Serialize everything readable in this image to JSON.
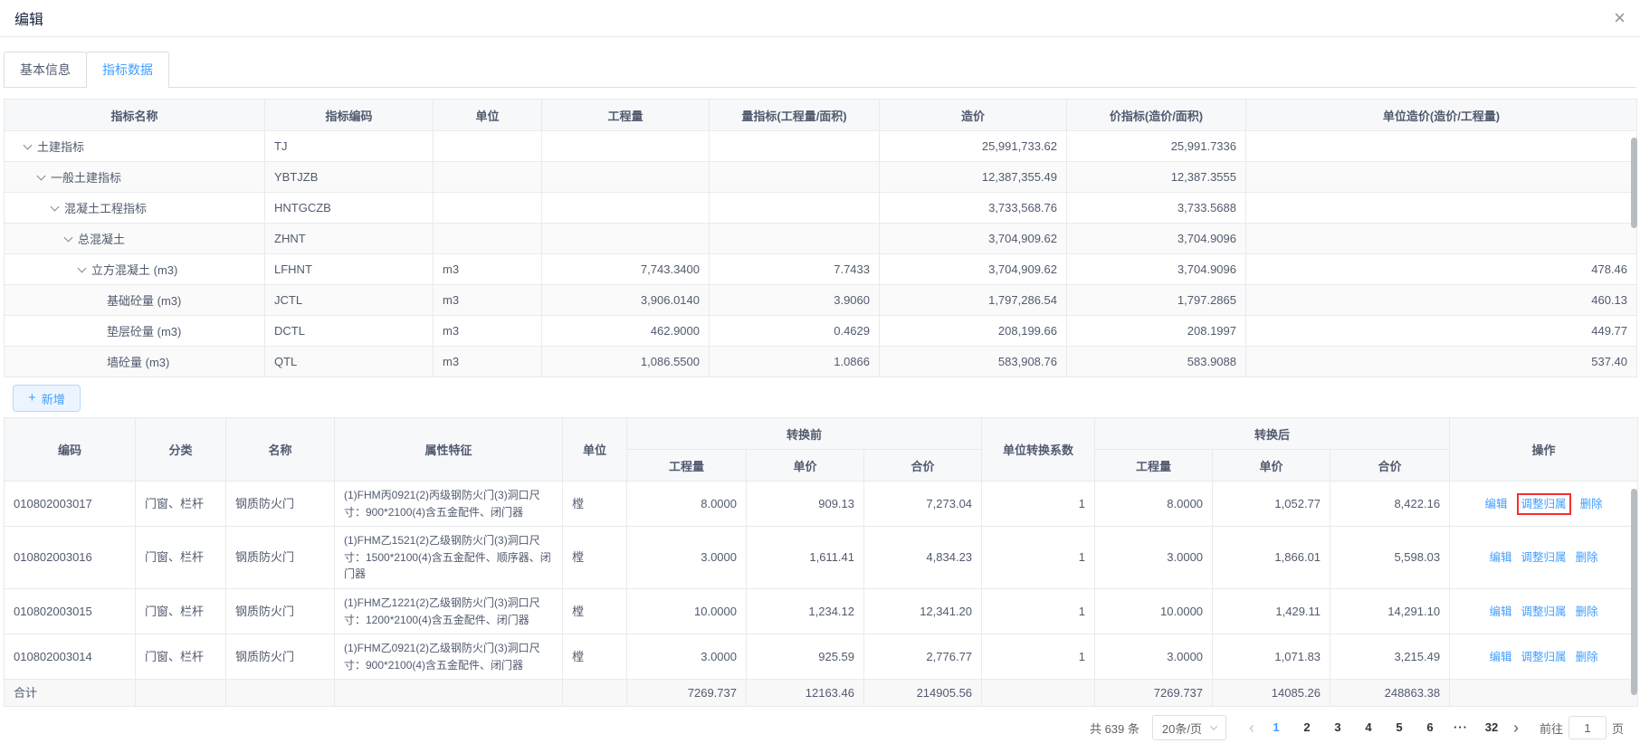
{
  "window": {
    "title": "编辑",
    "close_icon": "×"
  },
  "tabs": [
    {
      "label": "基本信息",
      "active": false
    },
    {
      "label": "指标数据",
      "active": true
    }
  ],
  "indicator_table": {
    "columns": [
      "指标名称",
      "指标编码",
      "单位",
      "工程量",
      "量指标(工程量/面积)",
      "造价",
      "价指标(造价/面积)",
      "单位造价(造价/工程量)"
    ],
    "rows": [
      {
        "level": 0,
        "expandable": true,
        "name": "土建指标",
        "code": "TJ",
        "unit": "",
        "quantity": "",
        "quantity_index": "",
        "cost": "25,991,733.62",
        "cost_index": "25,991.7336",
        "unit_cost": ""
      },
      {
        "level": 1,
        "expandable": true,
        "name": "一般土建指标",
        "code": "YBTJZB",
        "unit": "",
        "quantity": "",
        "quantity_index": "",
        "cost": "12,387,355.49",
        "cost_index": "12,387.3555",
        "unit_cost": ""
      },
      {
        "level": 2,
        "expandable": true,
        "name": "混凝土工程指标",
        "code": "HNTGCZB",
        "unit": "",
        "quantity": "",
        "quantity_index": "",
        "cost": "3,733,568.76",
        "cost_index": "3,733.5688",
        "unit_cost": ""
      },
      {
        "level": 3,
        "expandable": true,
        "name": "总混凝土",
        "code": "ZHNT",
        "unit": "",
        "quantity": "",
        "quantity_index": "",
        "cost": "3,704,909.62",
        "cost_index": "3,704.9096",
        "unit_cost": ""
      },
      {
        "level": 4,
        "expandable": true,
        "name": "立方混凝土 (m3)",
        "code": "LFHNT",
        "unit": "m3",
        "quantity": "7,743.3400",
        "quantity_index": "7.7433",
        "cost": "3,704,909.62",
        "cost_index": "3,704.9096",
        "unit_cost": "478.46"
      },
      {
        "level": 5,
        "expandable": false,
        "name": "基础砼量 (m3)",
        "code": "JCTL",
        "unit": "m3",
        "quantity": "3,906.0140",
        "quantity_index": "3.9060",
        "cost": "1,797,286.54",
        "cost_index": "1,797.2865",
        "unit_cost": "460.13"
      },
      {
        "level": 5,
        "expandable": false,
        "name": "垫层砼量 (m3)",
        "code": "DCTL",
        "unit": "m3",
        "quantity": "462.9000",
        "quantity_index": "0.4629",
        "cost": "208,199.66",
        "cost_index": "208.1997",
        "unit_cost": "449.77"
      },
      {
        "level": 5,
        "expandable": false,
        "name": "墙砼量 (m3)",
        "code": "QTL",
        "unit": "m3",
        "quantity": "1,086.5500",
        "quantity_index": "1.0866",
        "cost": "583,908.76",
        "cost_index": "583.9088",
        "unit_cost": "537.40"
      }
    ]
  },
  "add_button": {
    "icon": "+",
    "label": "新增"
  },
  "detail_table": {
    "header": {
      "code": "编码",
      "category": "分类",
      "name": "名称",
      "attributes": "属性特征",
      "unit": "单位",
      "before_group": "转换前",
      "after_group": "转换后",
      "quantity": "工程量",
      "unit_price": "单价",
      "total_price": "合价",
      "factor": "单位转换系数",
      "actions": "操作"
    },
    "rows": [
      {
        "code": "010802003017",
        "category": "门窗、栏杆",
        "name": "钢质防火门",
        "attributes": "(1)FHM丙0921(2)丙级钢防火门(3)洞口尺寸：900*2100(4)含五金配件、闭门器",
        "unit": "樘",
        "before": {
          "quantity": "8.0000",
          "unit_price": "909.13",
          "total_price": "7,273.04"
        },
        "factor": "1",
        "after": {
          "quantity": "8.0000",
          "unit_price": "1,052.77",
          "total_price": "8,422.16"
        },
        "actions": [
          "编辑",
          "调整归属",
          "删除"
        ],
        "highlighted_action": "调整归属"
      },
      {
        "code": "010802003016",
        "category": "门窗、栏杆",
        "name": "钢质防火门",
        "attributes": "(1)FHM乙1521(2)乙级钢防火门(3)洞口尺寸：1500*2100(4)含五金配件、顺序器、闭门器",
        "unit": "樘",
        "before": {
          "quantity": "3.0000",
          "unit_price": "1,611.41",
          "total_price": "4,834.23"
        },
        "factor": "1",
        "after": {
          "quantity": "3.0000",
          "unit_price": "1,866.01",
          "total_price": "5,598.03"
        },
        "actions": [
          "编辑",
          "调整归属",
          "删除"
        ],
        "highlighted_action": null
      },
      {
        "code": "010802003015",
        "category": "门窗、栏杆",
        "name": "钢质防火门",
        "attributes": "(1)FHM乙1221(2)乙级钢防火门(3)洞口尺寸：1200*2100(4)含五金配件、闭门器",
        "unit": "樘",
        "before": {
          "quantity": "10.0000",
          "unit_price": "1,234.12",
          "total_price": "12,341.20"
        },
        "factor": "1",
        "after": {
          "quantity": "10.0000",
          "unit_price": "1,429.11",
          "total_price": "14,291.10"
        },
        "actions": [
          "编辑",
          "调整归属",
          "删除"
        ],
        "highlighted_action": null
      },
      {
        "code": "010802003014",
        "category": "门窗、栏杆",
        "name": "钢质防火门",
        "attributes": "(1)FHM乙0921(2)乙级钢防火门(3)洞口尺寸：900*2100(4)含五金配件、闭门器",
        "unit": "樘",
        "before": {
          "quantity": "3.0000",
          "unit_price": "925.59",
          "total_price": "2,776.77"
        },
        "factor": "1",
        "after": {
          "quantity": "3.0000",
          "unit_price": "1,071.83",
          "total_price": "3,215.49"
        },
        "actions": [
          "编辑",
          "调整归属",
          "删除"
        ],
        "highlighted_action": null
      }
    ],
    "total_row": {
      "label": "合计",
      "before": {
        "quantity": "7269.737",
        "unit_price": "12163.46",
        "total_price": "214905.56"
      },
      "factor": "",
      "after": {
        "quantity": "7269.737",
        "unit_price": "14085.26",
        "total_price": "248863.38"
      }
    }
  },
  "pagination": {
    "total_text": "共 639 条",
    "page_size": "20条/页",
    "prev_icon": "‹",
    "next_icon": "›",
    "pages": [
      "1",
      "2",
      "3",
      "4",
      "5",
      "6"
    ],
    "ellipsis": "···",
    "last_page": "32",
    "active_page": "1",
    "goto_label": "前往",
    "goto_value": "1",
    "goto_unit": "页"
  },
  "colors": {
    "accent": "#409eff",
    "highlight_box": "#f52f2f",
    "header_bg": "#f7f8fa",
    "stripe_bg": "#fafafa",
    "border": "#e8eaec"
  }
}
